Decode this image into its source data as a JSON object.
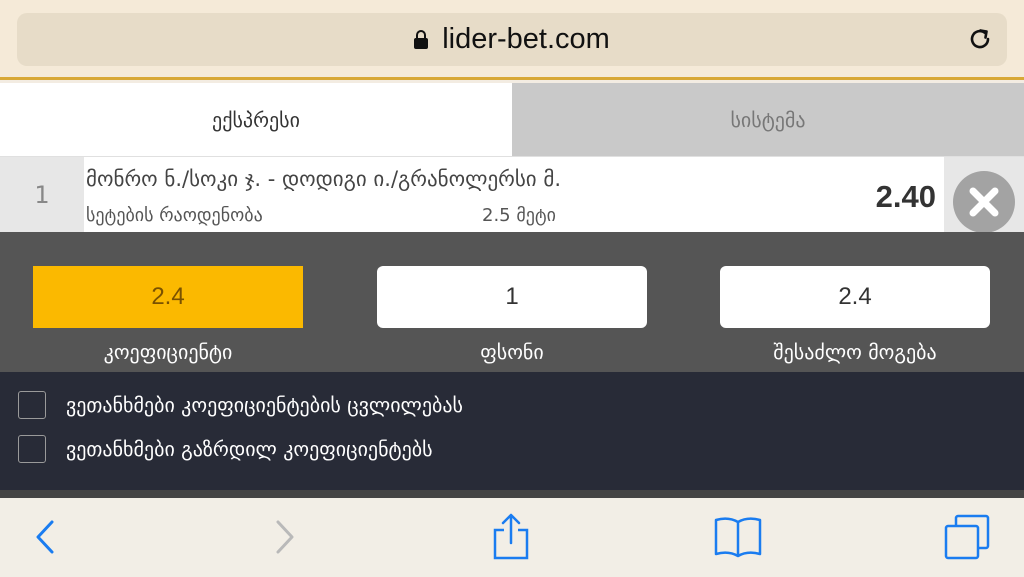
{
  "browser": {
    "url": "lider-bet.com",
    "lock_icon": "lock-icon",
    "reload_icon": "reload-icon"
  },
  "tabs": [
    {
      "label": "ექსპრესი",
      "active": true
    },
    {
      "label": "სისტემა",
      "active": false
    }
  ],
  "bet": {
    "index": "1",
    "match": "მონრო ნ./სოკი ჯ. - დოდიგი ი./გრანოლერსი მ.",
    "market": "სეტების რაოდენობა",
    "selection": "2.5 მეტი",
    "odds": "2.40",
    "remove_icon": "close-icon"
  },
  "stake_panel": {
    "coefficient": {
      "value": "2.4",
      "label": "კოეფიციენტი"
    },
    "stake": {
      "value": "1",
      "label": "ფსონი"
    },
    "possible_win": {
      "value": "2.4",
      "label": "შესაძლო მოგება"
    }
  },
  "options": [
    {
      "label": "ვეთანხმები კოეფიციენტების ცვლილებას",
      "checked": false
    },
    {
      "label": "ვეთანხმები გაზრდილ კოეფიციენტებს",
      "checked": false
    }
  ],
  "toolbar": {
    "back_icon": "chevron-left-icon",
    "forward_icon": "chevron-right-icon",
    "share_icon": "share-icon",
    "bookmarks_icon": "book-icon",
    "tabs_icon": "tabs-icon"
  },
  "colors": {
    "accent": "#fbb900",
    "panel": "#555555",
    "options_bg": "#282b37",
    "ios_blue": "#1a7cf0"
  }
}
